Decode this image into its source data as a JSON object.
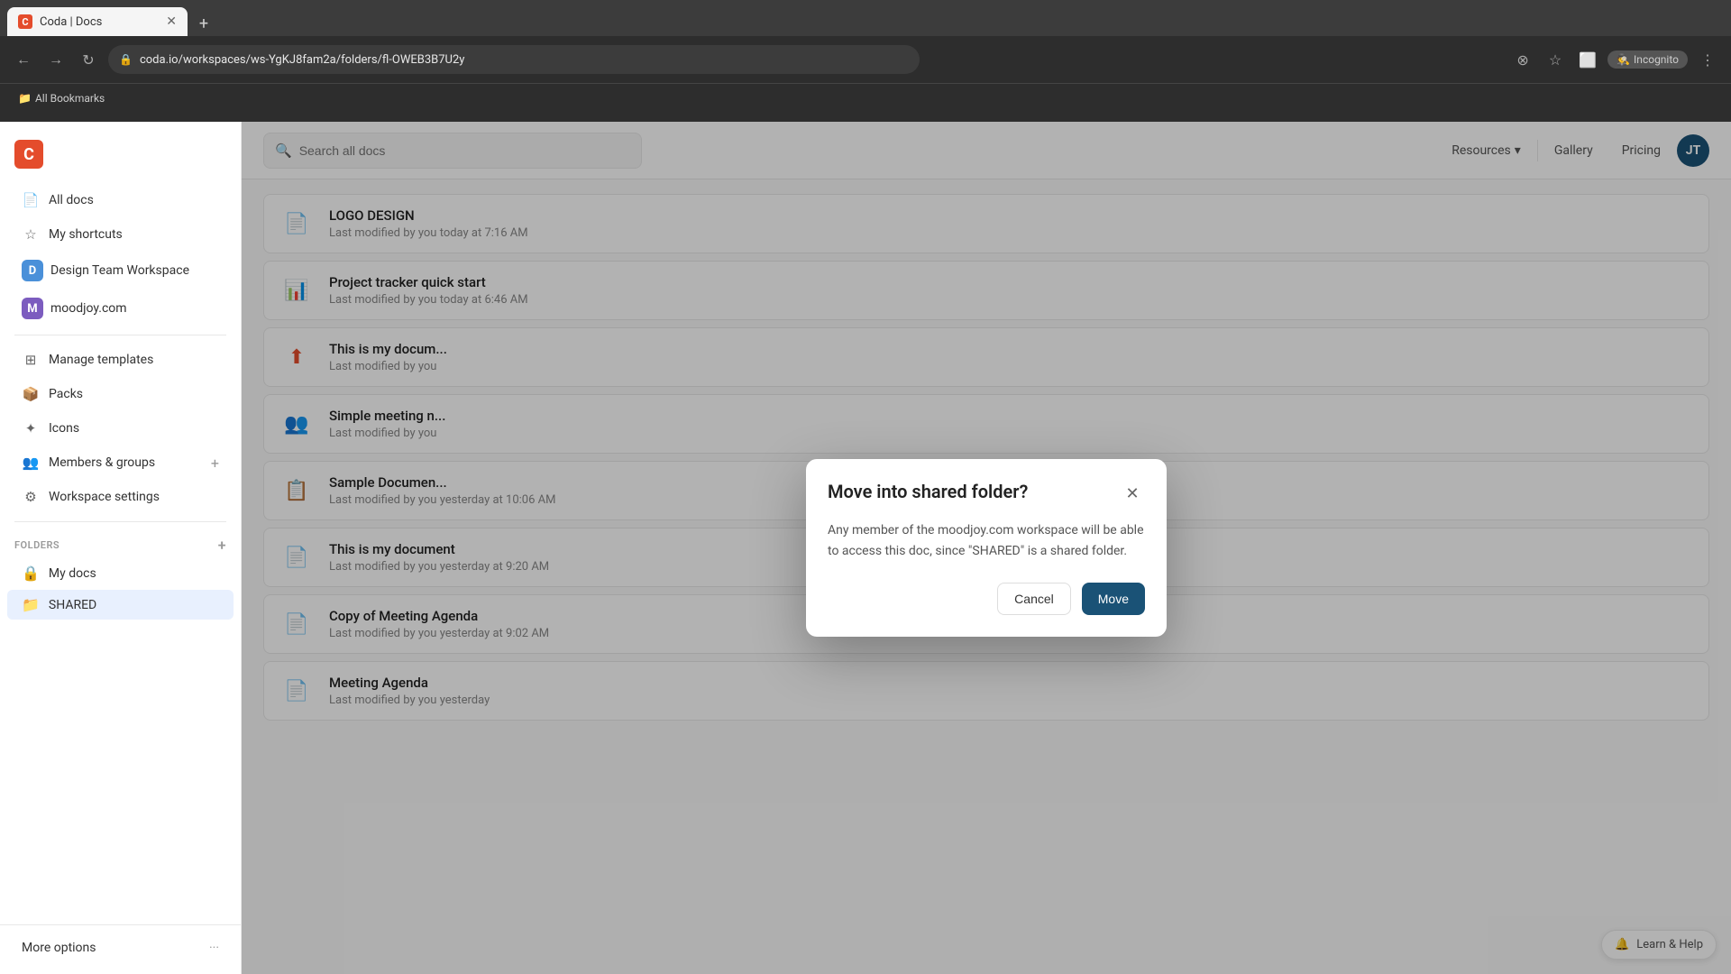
{
  "browser": {
    "tab_title": "Coda | Docs",
    "url": "coda.io/workspaces/ws-YgKJ8fam2a/folders/fl-OWEB3B7U2y",
    "incognito_label": "Incognito",
    "new_tab_symbol": "+",
    "bookmarks_label": "All Bookmarks"
  },
  "header": {
    "search_placeholder": "Search all docs",
    "resources_label": "Resources",
    "gallery_label": "Gallery",
    "pricing_label": "Pricing",
    "user_initials": "JT"
  },
  "sidebar": {
    "logo_letter": "C",
    "all_docs_label": "All docs",
    "my_shortcuts_label": "My shortcuts",
    "design_team_label": "Design Team Workspace",
    "design_team_badge": "D",
    "moodjoy_label": "moodjoy.com",
    "moodjoy_badge": "M",
    "manage_templates_label": "Manage templates",
    "packs_label": "Packs",
    "icons_label": "Icons",
    "members_label": "Members & groups",
    "workspace_settings_label": "Workspace settings",
    "folders_label": "FOLDERS",
    "my_docs_label": "My docs",
    "shared_label": "SHARED",
    "more_options_label": "More options"
  },
  "docs": [
    {
      "id": 1,
      "title": "LOGO DESIGN",
      "meta": "Last modified by you today at 7:16 AM",
      "icon": "📄"
    },
    {
      "id": 2,
      "title": "Project tracker quick start",
      "meta": "Last modified by you today at 6:46 AM",
      "icon": "📊"
    },
    {
      "id": 3,
      "title": "This is my docum...",
      "meta": "Last modified by you",
      "icon": "⬆️"
    },
    {
      "id": 4,
      "title": "Simple meeting n...",
      "meta": "Last modified by you",
      "icon": "👥"
    },
    {
      "id": 5,
      "title": "Sample Documen...",
      "meta": "Last modified by you yesterday at 10:06 AM",
      "icon": "📋"
    },
    {
      "id": 6,
      "title": "This is my document",
      "meta": "Last modified by you yesterday at 9:20 AM",
      "icon": "📄"
    },
    {
      "id": 7,
      "title": "Copy of Meeting Agenda",
      "meta": "Last modified by you yesterday at 9:02 AM",
      "icon": "📄"
    },
    {
      "id": 8,
      "title": "Meeting Agenda",
      "meta": "Last modified by you yesterday",
      "icon": "📄"
    }
  ],
  "modal": {
    "title": "Move into shared folder?",
    "body": "Any member of the moodjoy.com workspace will be able to access this doc, since \"SHARED\" is a shared folder.",
    "cancel_label": "Cancel",
    "move_label": "Move"
  },
  "learn_help": {
    "label": "Learn & Help"
  }
}
